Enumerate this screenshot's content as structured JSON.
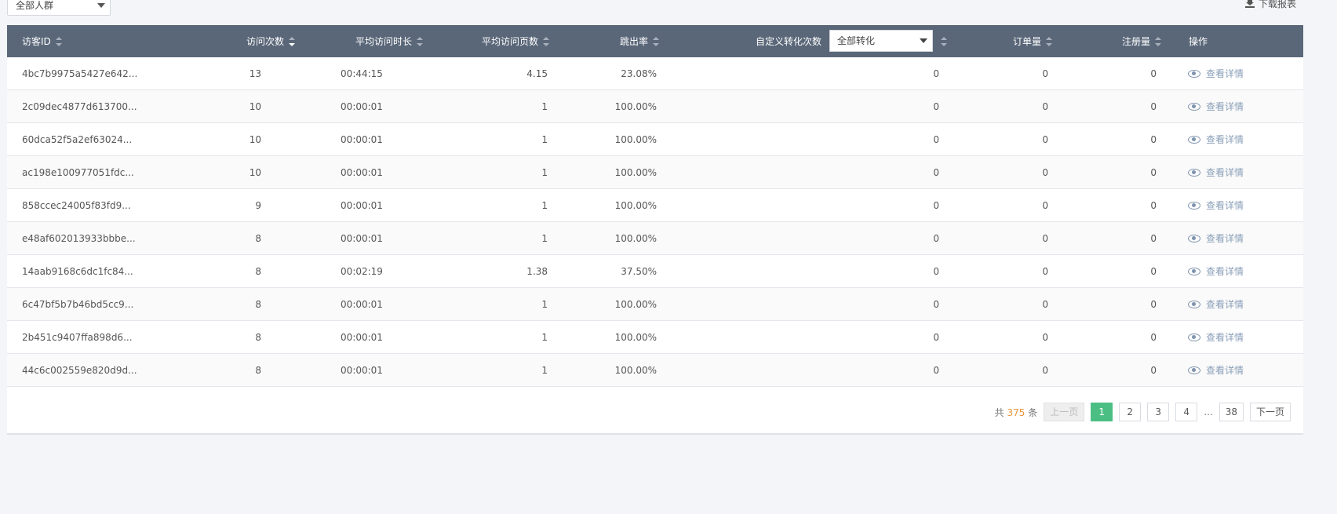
{
  "filters": {
    "crowd_select": "全部人群",
    "download_label": "下载报表"
  },
  "table": {
    "headers": {
      "visitor_id": "访客ID",
      "visits": "访问次数",
      "avg_duration": "平均访问时长",
      "avg_pages": "平均访问页数",
      "bounce_rate": "跳出率",
      "custom_conv": "自定义转化次数",
      "conv_select": "全部转化",
      "orders": "订单量",
      "registrations": "注册量",
      "actions": "操作"
    },
    "action_label": "查看详情",
    "rows": [
      {
        "id": "4bc7b9975a5427e642...",
        "visits": "13",
        "duration": "00:44:15",
        "pages": "4.15",
        "bounce": "23.08%",
        "conv": "0",
        "orders": "0",
        "regs": "0"
      },
      {
        "id": "2c09dec4877d613700...",
        "visits": "10",
        "duration": "00:00:01",
        "pages": "1",
        "bounce": "100.00%",
        "conv": "0",
        "orders": "0",
        "regs": "0"
      },
      {
        "id": "60dca52f5a2ef63024...",
        "visits": "10",
        "duration": "00:00:01",
        "pages": "1",
        "bounce": "100.00%",
        "conv": "0",
        "orders": "0",
        "regs": "0"
      },
      {
        "id": "ac198e100977051fdc...",
        "visits": "10",
        "duration": "00:00:01",
        "pages": "1",
        "bounce": "100.00%",
        "conv": "0",
        "orders": "0",
        "regs": "0"
      },
      {
        "id": "858ccec24005f83fd9...",
        "visits": "9",
        "duration": "00:00:01",
        "pages": "1",
        "bounce": "100.00%",
        "conv": "0",
        "orders": "0",
        "regs": "0"
      },
      {
        "id": "e48af602013933bbbe...",
        "visits": "8",
        "duration": "00:00:01",
        "pages": "1",
        "bounce": "100.00%",
        "conv": "0",
        "orders": "0",
        "regs": "0"
      },
      {
        "id": "14aab9168c6dc1fc84...",
        "visits": "8",
        "duration": "00:02:19",
        "pages": "1.38",
        "bounce": "37.50%",
        "conv": "0",
        "orders": "0",
        "regs": "0"
      },
      {
        "id": "6c47bf5b7b46bd5cc9...",
        "visits": "8",
        "duration": "00:00:01",
        "pages": "1",
        "bounce": "100.00%",
        "conv": "0",
        "orders": "0",
        "regs": "0"
      },
      {
        "id": "2b451c9407ffa898d6...",
        "visits": "8",
        "duration": "00:00:01",
        "pages": "1",
        "bounce": "100.00%",
        "conv": "0",
        "orders": "0",
        "regs": "0"
      },
      {
        "id": "44c6c002559e820d9d...",
        "visits": "8",
        "duration": "00:00:01",
        "pages": "1",
        "bounce": "100.00%",
        "conv": "0",
        "orders": "0",
        "regs": "0"
      }
    ]
  },
  "pagination": {
    "total_prefix": "共",
    "total_count": "375",
    "total_suffix": "条",
    "prev": "上一页",
    "pages": [
      "1",
      "2",
      "3",
      "4"
    ],
    "ellipsis": "...",
    "last": "38",
    "next": "下一页"
  },
  "colors": {
    "header_bg": "#5a6779",
    "active_page": "#4bbf83",
    "total_count": "#e8953a",
    "action_link": "#8a9fb8"
  }
}
